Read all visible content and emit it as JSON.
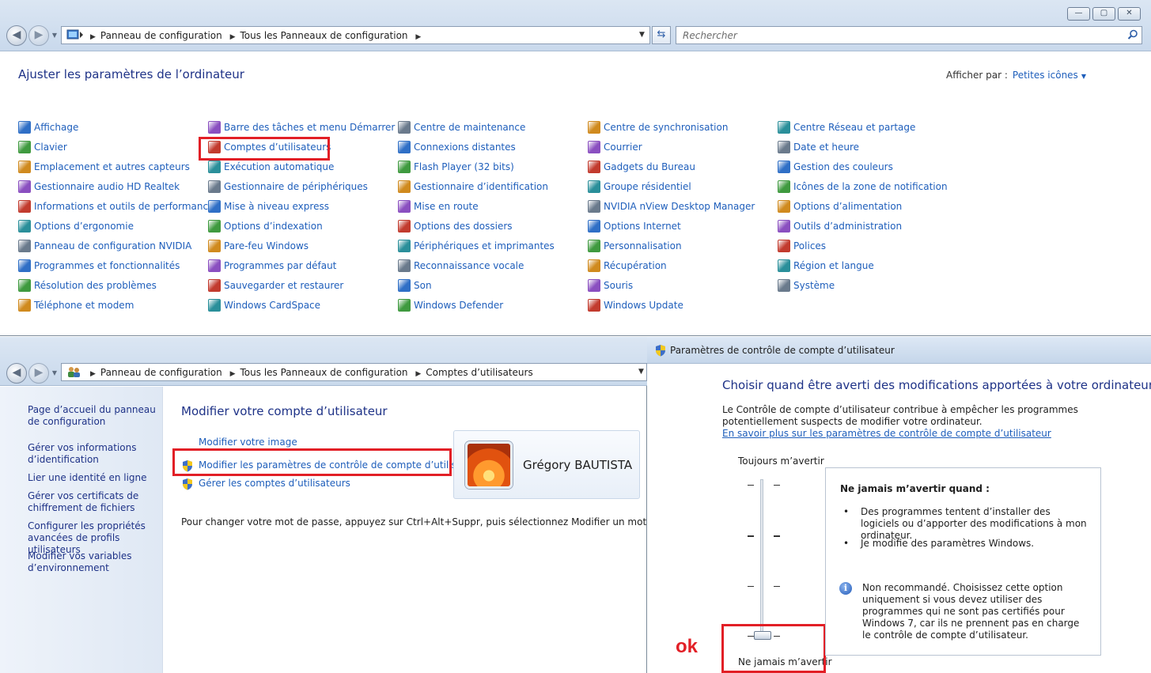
{
  "top_window": {
    "window_controls": [
      "—",
      "▢",
      "✕"
    ],
    "breadcrumb": [
      "Panneau de configuration",
      "Tous les Panneaux de configuration"
    ],
    "search_placeholder": "Rechercher",
    "heading": "Ajuster les paramètres de l’ordinateur",
    "view_by_label": "Afficher par :",
    "view_by_value": "Petites icônes",
    "items": [
      [
        "Affichage",
        "Clavier",
        "Emplacement et autres capteurs",
        "Gestionnaire audio HD Realtek",
        "Informations et outils de performance",
        "Options d’ergonomie",
        "Panneau de configuration NVIDIA",
        "Programmes et fonctionnalités",
        "Résolution des problèmes",
        "Téléphone et modem"
      ],
      [
        "Barre des tâches et menu Démarrer",
        "Comptes d’utilisateurs",
        "Exécution automatique",
        "Gestionnaire de périphériques",
        "Mise à niveau express",
        "Options d’indexation",
        "Pare-feu Windows",
        "Programmes par défaut",
        "Sauvegarder et restaurer",
        "Windows CardSpace"
      ],
      [
        "Centre de maintenance",
        "Connexions distantes",
        "Flash Player (32 bits)",
        "Gestionnaire d’identification",
        "Mise en route",
        "Options des dossiers",
        "Périphériques et imprimantes",
        "Reconnaissance vocale",
        "Son",
        "Windows Defender"
      ],
      [
        "Centre de synchronisation",
        "Courrier",
        "Gadgets du Bureau",
        "Groupe résidentiel",
        "NVIDIA nView Desktop Manager",
        "Options Internet",
        "Personnalisation",
        "Récupération",
        "Souris",
        "Windows Update"
      ],
      [
        "Centre Réseau et partage",
        "Date et heure",
        "Gestion des couleurs",
        "Icônes de la zone de notification",
        "Options d’alimentation",
        "Outils d’administration",
        "Polices",
        "Région et langue",
        "Système"
      ]
    ]
  },
  "accounts_window": {
    "breadcrumb": [
      "Panneau de configuration",
      "Tous les Panneaux de configuration",
      "Comptes d’utilisateurs"
    ],
    "sidebar_links": [
      "Page d’accueil du panneau de configuration",
      "Gérer vos informations d’identification",
      "Lier une identité en ligne",
      "Gérer vos certificats de chiffrement de fichiers",
      "Configurer les propriétés avancées de profils utilisateurs",
      "Modifier vos variables d’environnement"
    ],
    "title": "Modifier votre compte d’utilisateur",
    "links": {
      "change_picture": "Modifier votre image",
      "uac_settings": "Modifier les paramètres de contrôle de compte d’utilisateur",
      "manage_accounts": "Gérer les comptes d’utilisateurs"
    },
    "user_name": "Grégory BAUTISTA",
    "password_note": "Pour changer votre mot de passe, appuyez sur Ctrl+Alt+Suppr, puis sélectionnez Modifier un mot de passe."
  },
  "uac_window": {
    "title": "Paramètres de contrôle de compte d’utilisateur",
    "main_instruction": "Choisir quand être averti des modifications apportées à votre ordinateur",
    "description": "Le Contrôle de compte d’utilisateur contribue à empêcher les programmes potentiellement suspects de modifier votre ordinateur.",
    "learn_more": "En savoir plus sur les paramètres de contrôle de compte d’utilisateur",
    "slider_top_label": "Toujours m’avertir",
    "slider_bottom_label": "Ne jamais m’avertir",
    "slider_level": "1 of 4 (lowest)",
    "panel_title": "Ne jamais m’avertir quand :",
    "bullets": [
      "Des programmes tentent d’installer des logiciels ou d’apporter des modifications à mon ordinateur.",
      "Je modifie des paramètres Windows."
    ],
    "bullet_glyph": "•",
    "info_glyph": "i",
    "note": "Non recommandé. Choisissez cette option uniquement si vous devez utiliser des programmes qui ne sont pas certifiés pour Windows 7, car ils ne prennent pas en charge le contrôle de compte d’utilisateur.",
    "annotation": "ok"
  },
  "colors": {
    "link": "#1e5ebb",
    "heading": "#1e3287",
    "highlight": "#e21f26"
  }
}
